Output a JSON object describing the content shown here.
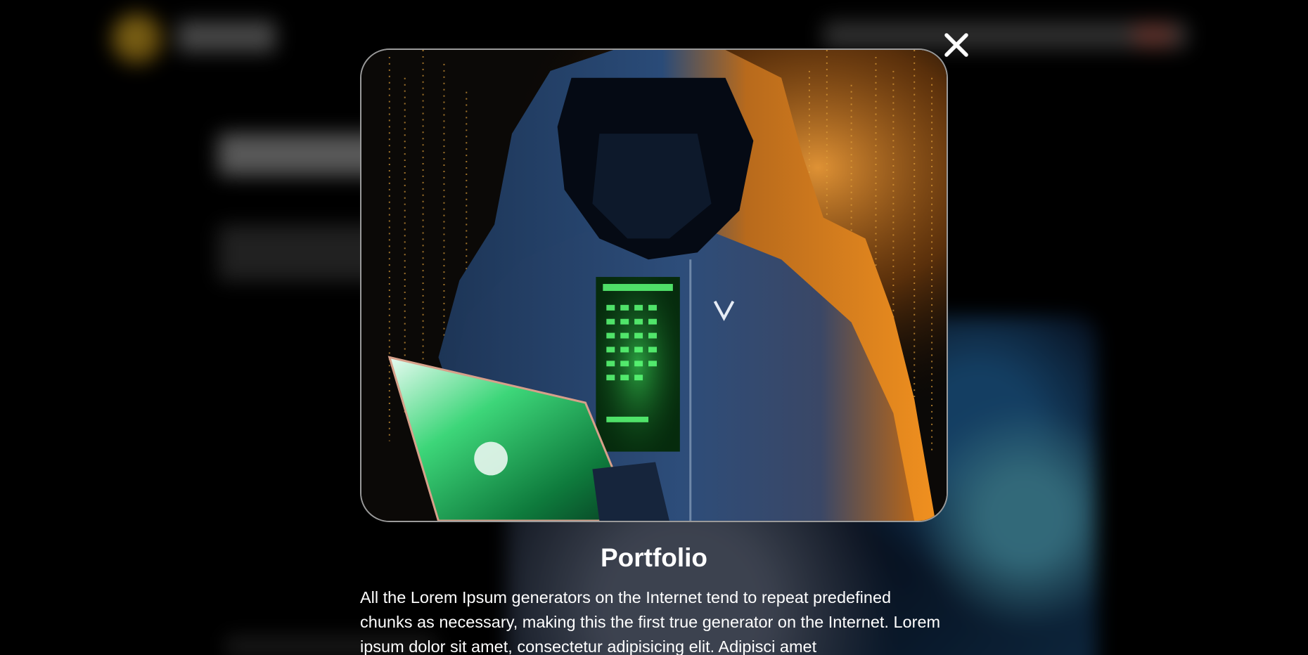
{
  "modal": {
    "title": "Portfolio",
    "description": "All the Lorem Ipsum generators on the Internet tend to repeat predefined chunks as necessary, making this the first true generator on the Internet. Lorem ipsum dolor sit amet, consectetur adipisicing elit. Adipisci amet",
    "close_icon": "close-icon",
    "image_icon": "hooded-hacker-laptop-image"
  },
  "colors": {
    "background": "#000000",
    "hood_orange": "#e88a1e",
    "jacket_blue": "#27466e",
    "screen_green": "#39e05a",
    "text": "#ffffff"
  }
}
